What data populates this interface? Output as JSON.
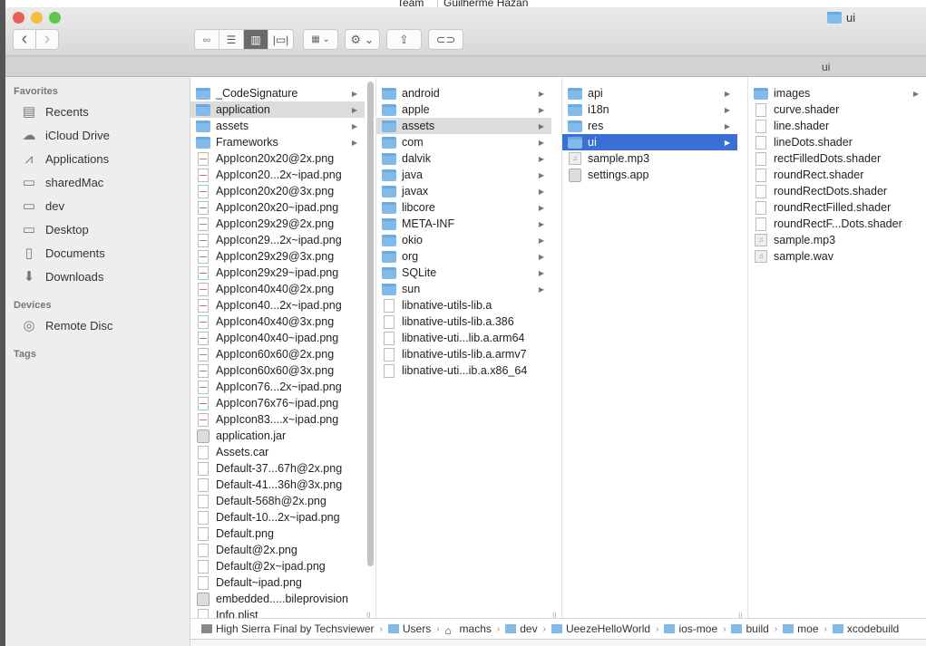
{
  "background": {
    "team_label": "Team",
    "team_value": "Guilherme Hazan"
  },
  "window": {
    "title": "ui",
    "tab_title": "ui",
    "colors": {
      "selection": "#3a6fd6",
      "inactive_selection": "#dcdcdc",
      "folder": "#82bbea"
    }
  },
  "toolbar": {
    "back": "‹",
    "forward": "›",
    "views": [
      "icon-view",
      "list-view",
      "column-view",
      "cover-flow-view"
    ],
    "active_view": "column-view",
    "arrange": "arrange-icon",
    "action": "gear-icon",
    "share": "share-icon",
    "tags": "tag-icon"
  },
  "sidebar": {
    "favorites_label": "Favorites",
    "favorites": [
      {
        "label": "Recents",
        "icon": "recents-icon"
      },
      {
        "label": "iCloud Drive",
        "icon": "cloud-icon"
      },
      {
        "label": "Applications",
        "icon": "applications-icon"
      },
      {
        "label": "sharedMac",
        "icon": "folder-icon"
      },
      {
        "label": "dev",
        "icon": "folder-icon"
      },
      {
        "label": "Desktop",
        "icon": "desktop-icon"
      },
      {
        "label": "Documents",
        "icon": "documents-icon"
      },
      {
        "label": "Downloads",
        "icon": "downloads-icon"
      }
    ],
    "devices_label": "Devices",
    "devices": [
      {
        "label": "Remote Disc",
        "icon": "disc-icon"
      }
    ],
    "tags_label": "Tags"
  },
  "columns": [
    {
      "items": [
        {
          "name": "_CodeSignature",
          "type": "folder"
        },
        {
          "name": "application",
          "type": "folder",
          "selected": "gray"
        },
        {
          "name": "assets",
          "type": "folder"
        },
        {
          "name": "Frameworks",
          "type": "folder"
        },
        {
          "name": "AppIcon20x20@2x.png",
          "type": "img"
        },
        {
          "name": "AppIcon20...2x~ipad.png",
          "type": "img"
        },
        {
          "name": "AppIcon20x20@3x.png",
          "type": "img"
        },
        {
          "name": "AppIcon20x20~ipad.png",
          "type": "img"
        },
        {
          "name": "AppIcon29x29@2x.png",
          "type": "img"
        },
        {
          "name": "AppIcon29...2x~ipad.png",
          "type": "img"
        },
        {
          "name": "AppIcon29x29@3x.png",
          "type": "img"
        },
        {
          "name": "AppIcon29x29~ipad.png",
          "type": "img"
        },
        {
          "name": "AppIcon40x40@2x.png",
          "type": "img"
        },
        {
          "name": "AppIcon40...2x~ipad.png",
          "type": "img"
        },
        {
          "name": "AppIcon40x40@3x.png",
          "type": "img"
        },
        {
          "name": "AppIcon40x40~ipad.png",
          "type": "img"
        },
        {
          "name": "AppIcon60x60@2x.png",
          "type": "img"
        },
        {
          "name": "AppIcon60x60@3x.png",
          "type": "img"
        },
        {
          "name": "AppIcon76...2x~ipad.png",
          "type": "img"
        },
        {
          "name": "AppIcon76x76~ipad.png",
          "type": "img"
        },
        {
          "name": "AppIcon83....x~ipad.png",
          "type": "img"
        },
        {
          "name": "application.jar",
          "type": "app"
        },
        {
          "name": "Assets.car",
          "type": "page"
        },
        {
          "name": "Default-37...67h@2x.png",
          "type": "page"
        },
        {
          "name": "Default-41...36h@3x.png",
          "type": "page"
        },
        {
          "name": "Default-568h@2x.png",
          "type": "page"
        },
        {
          "name": "Default-10...2x~ipad.png",
          "type": "page"
        },
        {
          "name": "Default.png",
          "type": "page"
        },
        {
          "name": "Default@2x.png",
          "type": "page"
        },
        {
          "name": "Default@2x~ipad.png",
          "type": "page"
        },
        {
          "name": "Default~ipad.png",
          "type": "page"
        },
        {
          "name": "embedded.....bileprovision",
          "type": "app"
        },
        {
          "name": "Info.plist",
          "type": "page"
        }
      ]
    },
    {
      "items": [
        {
          "name": "android",
          "type": "folder"
        },
        {
          "name": "apple",
          "type": "folder"
        },
        {
          "name": "assets",
          "type": "folder",
          "selected": "gray"
        },
        {
          "name": "com",
          "type": "folder"
        },
        {
          "name": "dalvik",
          "type": "folder"
        },
        {
          "name": "java",
          "type": "folder"
        },
        {
          "name": "javax",
          "type": "folder"
        },
        {
          "name": "libcore",
          "type": "folder"
        },
        {
          "name": "META-INF",
          "type": "folder"
        },
        {
          "name": "okio",
          "type": "folder"
        },
        {
          "name": "org",
          "type": "folder"
        },
        {
          "name": "SQLite",
          "type": "folder"
        },
        {
          "name": "sun",
          "type": "folder"
        },
        {
          "name": "libnative-utils-lib.a",
          "type": "page"
        },
        {
          "name": "libnative-utils-lib.a.386",
          "type": "page"
        },
        {
          "name": "libnative-uti...lib.a.arm64",
          "type": "page"
        },
        {
          "name": "libnative-utils-lib.a.armv7",
          "type": "page"
        },
        {
          "name": "libnative-uti...ib.a.x86_64",
          "type": "page"
        }
      ]
    },
    {
      "items": [
        {
          "name": "api",
          "type": "folder"
        },
        {
          "name": "i18n",
          "type": "folder"
        },
        {
          "name": "res",
          "type": "folder"
        },
        {
          "name": "ui",
          "type": "folder",
          "selected": "blue"
        },
        {
          "name": "sample.mp3",
          "type": "audio"
        },
        {
          "name": "settings.app",
          "type": "app"
        }
      ]
    },
    {
      "items": [
        {
          "name": "images",
          "type": "folder"
        },
        {
          "name": "curve.shader",
          "type": "page"
        },
        {
          "name": "line.shader",
          "type": "page"
        },
        {
          "name": "lineDots.shader",
          "type": "page"
        },
        {
          "name": "rectFilledDots.shader",
          "type": "page"
        },
        {
          "name": "roundRect.shader",
          "type": "page"
        },
        {
          "name": "roundRectDots.shader",
          "type": "page"
        },
        {
          "name": "roundRectFilled.shader",
          "type": "page"
        },
        {
          "name": "roundRectF...Dots.shader",
          "type": "page"
        },
        {
          "name": "sample.mp3",
          "type": "audio"
        },
        {
          "name": "sample.wav",
          "type": "audio"
        }
      ]
    }
  ],
  "pathbar": [
    {
      "label": "High Sierra Final by Techsviewer",
      "icon": "disk-icon"
    },
    {
      "label": "Users",
      "icon": "users-folder-icon"
    },
    {
      "label": "machs",
      "icon": "home-icon"
    },
    {
      "label": "dev",
      "icon": "folder-icon"
    },
    {
      "label": "UeezeHelloWorld",
      "icon": "folder-icon"
    },
    {
      "label": "ios-moe",
      "icon": "folder-icon"
    },
    {
      "label": "build",
      "icon": "folder-icon"
    },
    {
      "label": "moe",
      "icon": "folder-icon"
    },
    {
      "label": "xcodebuild",
      "icon": "folder-icon"
    }
  ]
}
